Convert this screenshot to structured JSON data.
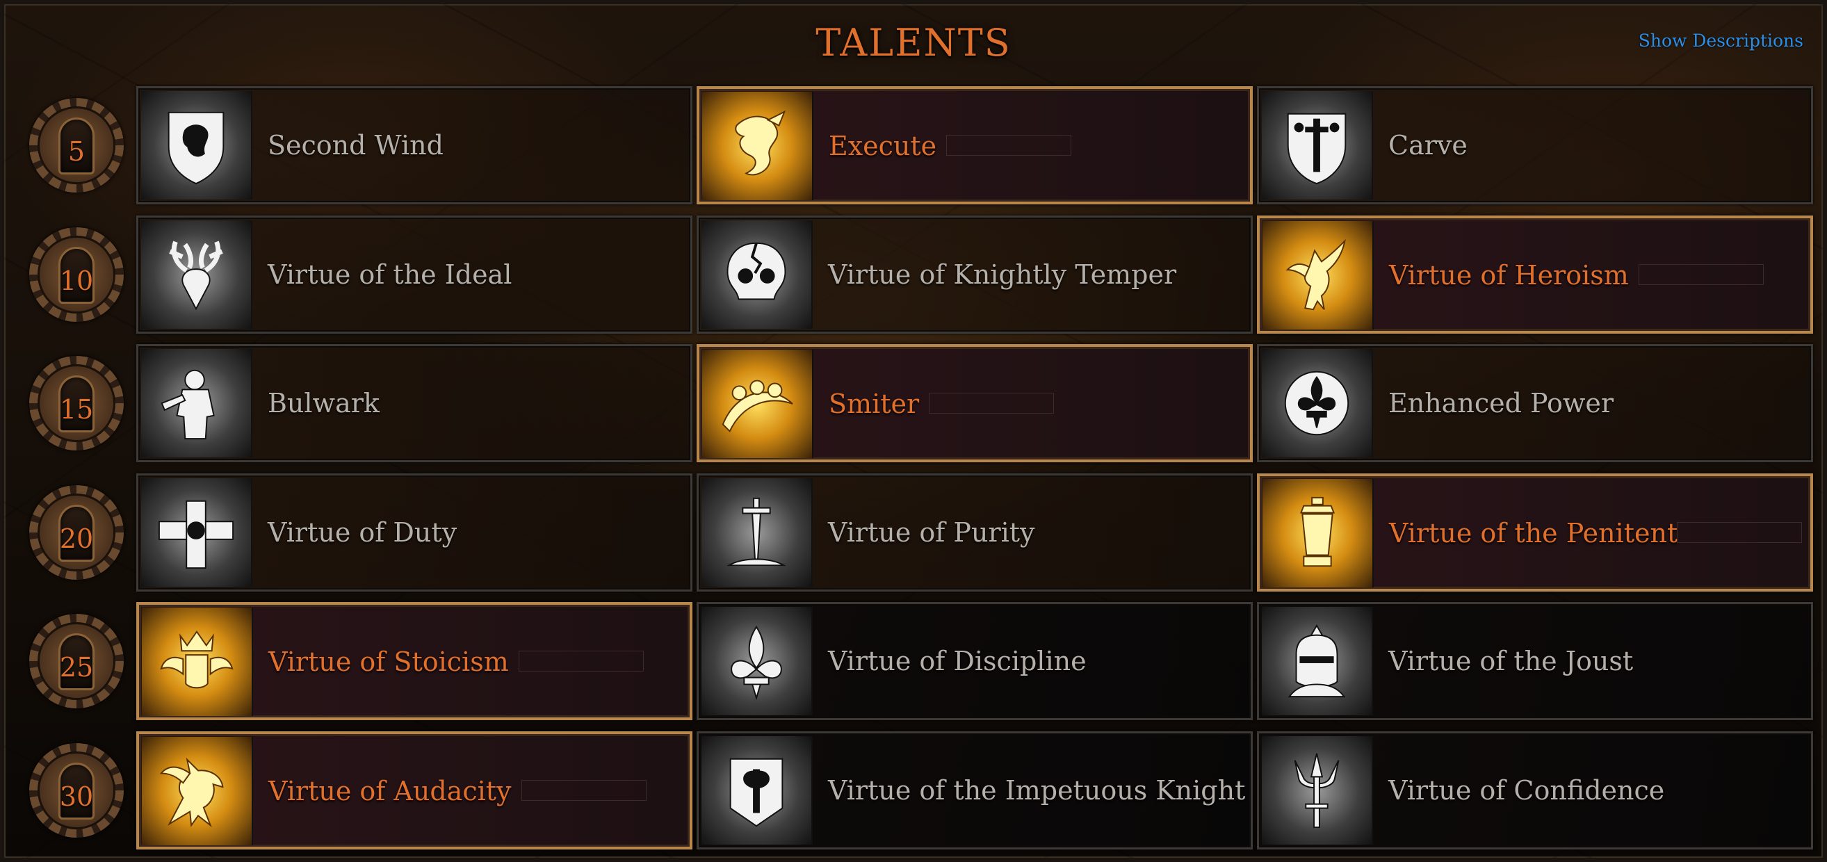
{
  "title": "TALENTS",
  "show_descriptions_label": "Show Descriptions",
  "colors": {
    "accent": "#e0702c",
    "link": "#2c8fe6",
    "unselected_text": "#b5b0aa",
    "selected_border": "#b8874e"
  },
  "rows": [
    {
      "level": "5",
      "talents": [
        {
          "name": "Second Wind",
          "icon": "lion-shield-icon",
          "selected": false
        },
        {
          "name": "Execute",
          "icon": "dragon-icon",
          "selected": true
        },
        {
          "name": "Carve",
          "icon": "sword-shield-icon",
          "selected": false
        }
      ]
    },
    {
      "level": "10",
      "talents": [
        {
          "name": "Virtue of the Ideal",
          "icon": "stag-head-icon",
          "selected": false
        },
        {
          "name": "Virtue of Knightly Temper",
          "icon": "cracked-skull-icon",
          "selected": false
        },
        {
          "name": "Virtue of Heroism",
          "icon": "pegasus-icon",
          "selected": true
        }
      ]
    },
    {
      "level": "15",
      "talents": [
        {
          "name": "Bulwark",
          "icon": "knight-silhouette-icon",
          "selected": false
        },
        {
          "name": "Smiter",
          "icon": "sweep-strike-icon",
          "selected": true
        },
        {
          "name": "Enhanced Power",
          "icon": "fleur-de-lis-orb-icon",
          "selected": false
        }
      ]
    },
    {
      "level": "20",
      "talents": [
        {
          "name": "Virtue of Duty",
          "icon": "banner-cross-icon",
          "selected": false
        },
        {
          "name": "Virtue of Purity",
          "icon": "sword-in-light-icon",
          "selected": false
        },
        {
          "name": "Virtue of the Penitent",
          "icon": "lantern-icon",
          "selected": true
        }
      ]
    },
    {
      "level": "25",
      "talents": [
        {
          "name": "Virtue of Stoicism",
          "icon": "winged-crown-icon",
          "selected": true
        },
        {
          "name": "Virtue of Discipline",
          "icon": "fleur-de-lis-icon",
          "selected": false
        },
        {
          "name": "Virtue of the Joust",
          "icon": "knight-helmet-icon",
          "selected": false
        }
      ]
    },
    {
      "level": "30",
      "talents": [
        {
          "name": "Virtue of Audacity",
          "icon": "rearing-dragon-icon",
          "selected": true
        },
        {
          "name": "Virtue of the Impetuous Knight",
          "icon": "axe-banner-icon",
          "selected": false
        },
        {
          "name": "Virtue of Confidence",
          "icon": "trident-icon",
          "selected": false
        }
      ]
    }
  ]
}
